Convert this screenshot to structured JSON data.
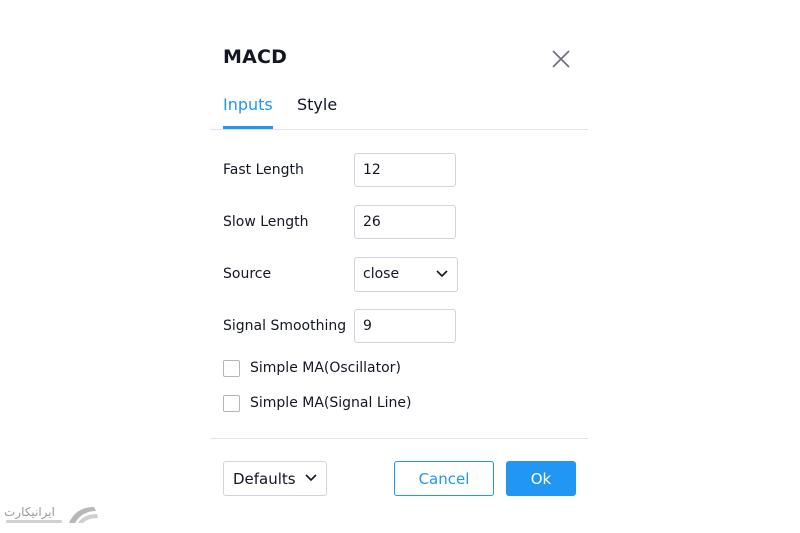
{
  "dialog": {
    "title": "MACD",
    "tabs": [
      {
        "label": "Inputs",
        "active": true
      },
      {
        "label": "Style",
        "active": false
      }
    ],
    "inputs": {
      "fast_length": {
        "label": "Fast Length",
        "value": "12"
      },
      "slow_length": {
        "label": "Slow Length",
        "value": "26"
      },
      "source": {
        "label": "Source",
        "value": "close"
      },
      "signal_smoothing": {
        "label": "Signal Smoothing",
        "value": "9"
      }
    },
    "checkboxes": [
      {
        "label": "Simple MA(Oscillator)",
        "checked": false
      },
      {
        "label": "Simple MA(Signal Line)",
        "checked": false
      }
    ],
    "footer": {
      "defaults_label": "Defaults",
      "cancel_label": "Cancel",
      "ok_label": "Ok"
    }
  },
  "watermark": {
    "text": "ایرانیکارت"
  },
  "colors": {
    "accent": "#2196f3",
    "text": "#131722",
    "border": "#d1d4dc",
    "divider": "#e0e3eb"
  },
  "icons": {
    "close": "close-icon",
    "dropdown": "chevron-down-icon",
    "logo": "logo-icon"
  }
}
